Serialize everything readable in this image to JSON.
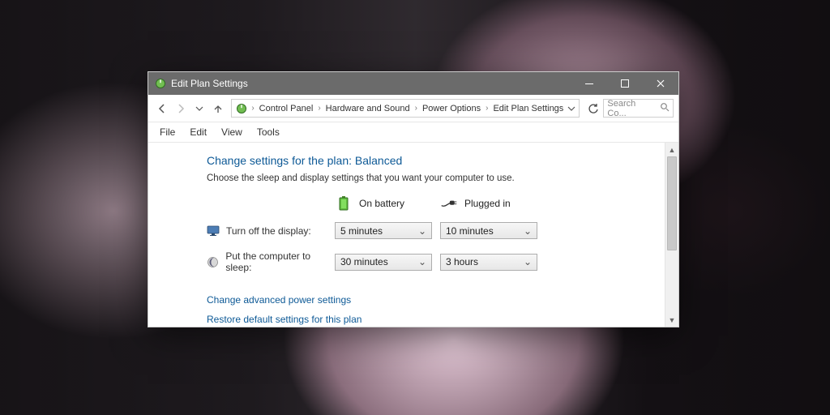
{
  "window": {
    "title": "Edit Plan Settings"
  },
  "breadcrumb": {
    "items": [
      "Control Panel",
      "Hardware and Sound",
      "Power Options",
      "Edit Plan Settings"
    ]
  },
  "search": {
    "placeholder": "Search Co..."
  },
  "menubar": {
    "items": [
      "File",
      "Edit",
      "View",
      "Tools"
    ]
  },
  "page": {
    "heading": "Change settings for the plan: Balanced",
    "sub": "Choose the sleep and display settings that you want your computer to use.",
    "columns": {
      "battery": "On battery",
      "plugged": "Plugged in"
    },
    "rows": {
      "display": {
        "label": "Turn off the display:",
        "battery": "5 minutes",
        "plugged": "10 minutes"
      },
      "sleep": {
        "label": "Put the computer to sleep:",
        "battery": "30 minutes",
        "plugged": "3 hours"
      }
    },
    "links": {
      "advanced": "Change advanced power settings",
      "restore": "Restore default settings for this plan"
    }
  }
}
